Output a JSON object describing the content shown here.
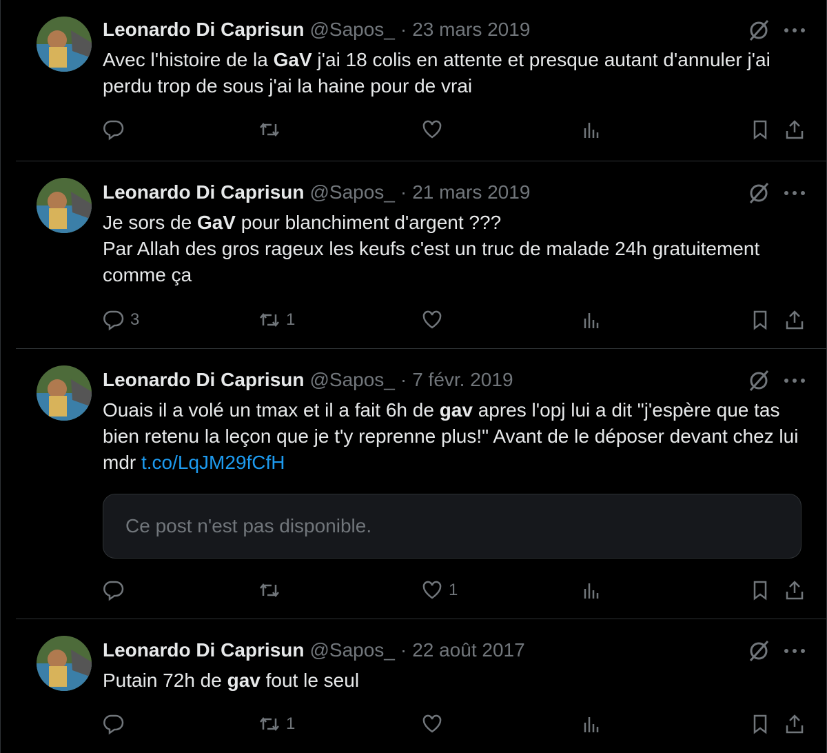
{
  "tweets": [
    {
      "name": "Leonardo Di Caprisun",
      "handle": "@Sapos_",
      "separator": "·",
      "date": "23 mars 2019",
      "text_parts": [
        "Avec l'histoire de la ",
        "GaV",
        " j'ai 18 colis en attente et presque autant d'annuler j'ai perdu trop de sous j'ai la haine pour de vrai"
      ],
      "replies": "",
      "retweets": "",
      "likes": ""
    },
    {
      "name": "Leonardo Di Caprisun",
      "handle": "@Sapos_",
      "separator": "·",
      "date": "21 mars 2019",
      "text_line1_parts": [
        "Je sors de ",
        "GaV",
        " pour blanchiment d'argent ???"
      ],
      "text_line2": "Par Allah des gros rageux les keufs c'est un truc de malade 24h gratuitement comme ça",
      "replies": "3",
      "retweets": "1",
      "likes": ""
    },
    {
      "name": "Leonardo Di Caprisun",
      "handle": "@Sapos_",
      "separator": "·",
      "date": "7 févr. 2019",
      "text_parts": [
        "Ouais il a volé un tmax et il a fait 6h de ",
        "gav",
        " apres l'opj lui a dit \"j'espère que tas bien retenu la leçon que je t'y reprenne plus!\" Avant de le déposer devant chez lui mdr "
      ],
      "link": "t.co/LqJM29fCfH",
      "card_text": "Ce post n'est pas disponible.",
      "replies": "",
      "retweets": "",
      "likes": "1"
    },
    {
      "name": "Leonardo Di Caprisun",
      "handle": "@Sapos_",
      "separator": "·",
      "date": "22 août 2017",
      "text_parts": [
        "Putain 72h de ",
        "gav",
        " fout le seul"
      ],
      "replies": "",
      "retweets": "1",
      "likes": ""
    }
  ],
  "icons": {
    "reply": "reply-icon",
    "retweet": "retweet-icon",
    "like": "heart-icon",
    "views": "views-icon",
    "bookmark": "bookmark-icon",
    "share": "share-icon",
    "grok": "grok-icon",
    "more": "more-icon"
  },
  "colors": {
    "background": "#000000",
    "text": "#e7e9ea",
    "muted": "#71767b",
    "link": "#1d9bf0",
    "divider": "#2f3336"
  }
}
